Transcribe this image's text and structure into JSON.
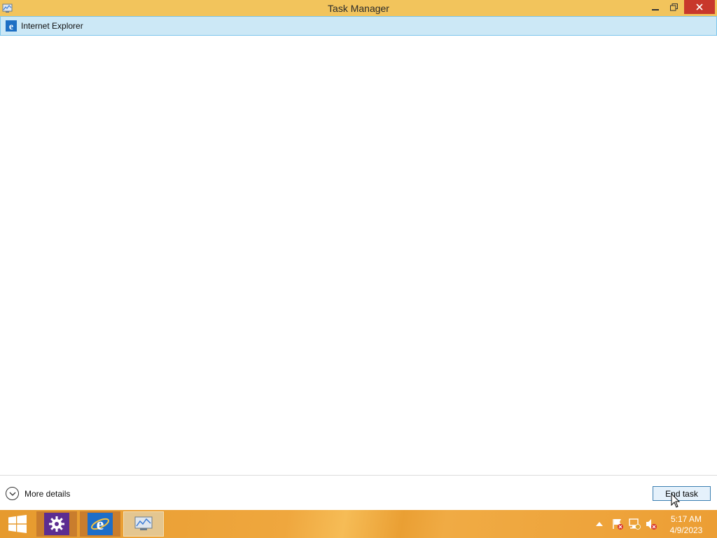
{
  "window": {
    "title": "Task Manager"
  },
  "apps": [
    {
      "name": "Internet Explorer",
      "icon": "internet-explorer-icon"
    }
  ],
  "footer": {
    "more_details_label": "More details",
    "end_task_label": "End task"
  },
  "taskbar": {
    "pinned": [
      {
        "name": "Settings",
        "icon": "gear-icon"
      },
      {
        "name": "Internet Explorer",
        "icon": "internet-explorer-icon"
      },
      {
        "name": "Task Manager",
        "icon": "task-manager-icon",
        "active": true
      }
    ],
    "clock": {
      "time": "5:17 AM",
      "date": "4/9/2023"
    }
  },
  "colors": {
    "titlebar": "#f2c45c",
    "selection": "#cce8f6",
    "close_button": "#c8382b",
    "taskbar": "#e69a2e"
  }
}
